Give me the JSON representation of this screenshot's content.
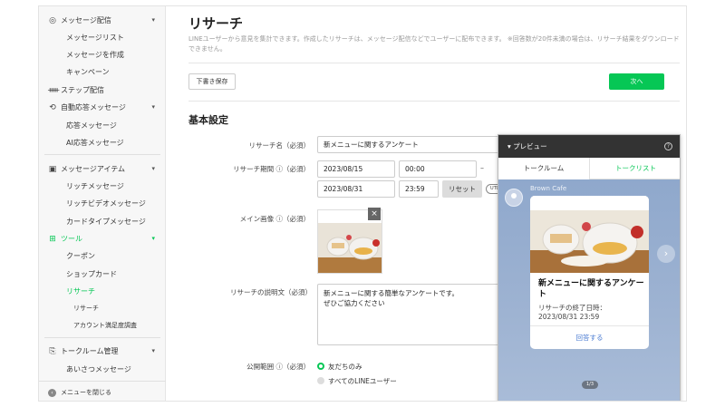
{
  "sidebar": {
    "items": [
      {
        "label": "メッセージ配信",
        "icon": "broadcast-icon",
        "chevron": "▾",
        "level": 0
      },
      {
        "label": "メッセージリスト",
        "level": 1
      },
      {
        "label": "メッセージを作成",
        "level": 1
      },
      {
        "label": "キャンペーン",
        "level": 1
      },
      {
        "label": "ステップ配信",
        "icon": "step-icon",
        "level": 0
      },
      {
        "label": "自動応答メッセージ",
        "icon": "auto-reply-icon",
        "chevron": "▾",
        "level": 0
      },
      {
        "label": "応答メッセージ",
        "level": 1
      },
      {
        "label": "AI応答メッセージ",
        "level": 1
      },
      {
        "label": "メッセージアイテム",
        "icon": "message-item-icon",
        "chevron": "▾",
        "level": 0
      },
      {
        "label": "リッチメッセージ",
        "level": 1
      },
      {
        "label": "リッチビデオメッセージ",
        "level": 1
      },
      {
        "label": "カードタイプメッセージ",
        "level": 1
      },
      {
        "label": "ツール",
        "icon": "tools-icon",
        "chevron": "▾",
        "level": 0,
        "active": true
      },
      {
        "label": "クーポン",
        "level": 1
      },
      {
        "label": "ショップカード",
        "level": 1
      },
      {
        "label": "リサーチ",
        "level": 1,
        "active": true
      },
      {
        "label": "リサーチ",
        "level": 2
      },
      {
        "label": "アカウント満足度調査",
        "level": 2
      },
      {
        "label": "トークルーム管理",
        "icon": "talkroom-icon",
        "chevron": "▾",
        "level": 0
      },
      {
        "label": "あいさつメッセージ",
        "level": 1
      }
    ],
    "footer_label": "メニューを閉じる"
  },
  "main": {
    "title": "リサーチ",
    "description": "LINEユーザーから意見を集計できます。作成したリサーチは、メッセージ配信などでユーザーに配布できます。 ※回答数が20件未満の場合は、リサーチ結果をダウンロードできません。",
    "draft_button": "下書き保存",
    "next_button": "次へ",
    "section_title": "基本設定",
    "form": {
      "name_label": "リサーチ名（必須）",
      "name_value": "新メニューに関するアンケート",
      "period_label": "リサーチ期間 ⓘ（必須）",
      "start_date": "2023/08/15",
      "start_time": "00:00",
      "period_dash": "–",
      "end_date": "2023/08/31",
      "end_time": "23:59",
      "reset_button": "リセット",
      "tz_badge": "UTC",
      "image_label": "メイン画像 ⓘ（必須）",
      "remove_image": "×",
      "desc_label": "リサーチの説明文（必須）",
      "desc_line1": "新メニューに関する簡単なアンケートです。",
      "desc_line2": "ぜひご協力ください",
      "audience_label": "公開範囲 ⓘ（必須）",
      "audience_options": [
        "友だちのみ",
        "すべてのLINEユーザー"
      ],
      "audience_selected": "友だちのみ"
    }
  },
  "preview": {
    "title": "▾ プレビュー",
    "help": "?",
    "tabs": [
      "トークルーム",
      "トークリスト"
    ],
    "active_tab": "トークルーム",
    "sender": "Brown Cafe",
    "card_title": "新メニューに関するアンケート",
    "card_sub_line1": "リサーチの終了日時：",
    "card_sub_line2": "2023/08/31 23:59",
    "card_button": "回答する",
    "next_arrow": "›",
    "pager": "1/3"
  },
  "colors": {
    "accent": "#06c755",
    "link": "#4a7bd2",
    "preview_header": "#333333"
  }
}
